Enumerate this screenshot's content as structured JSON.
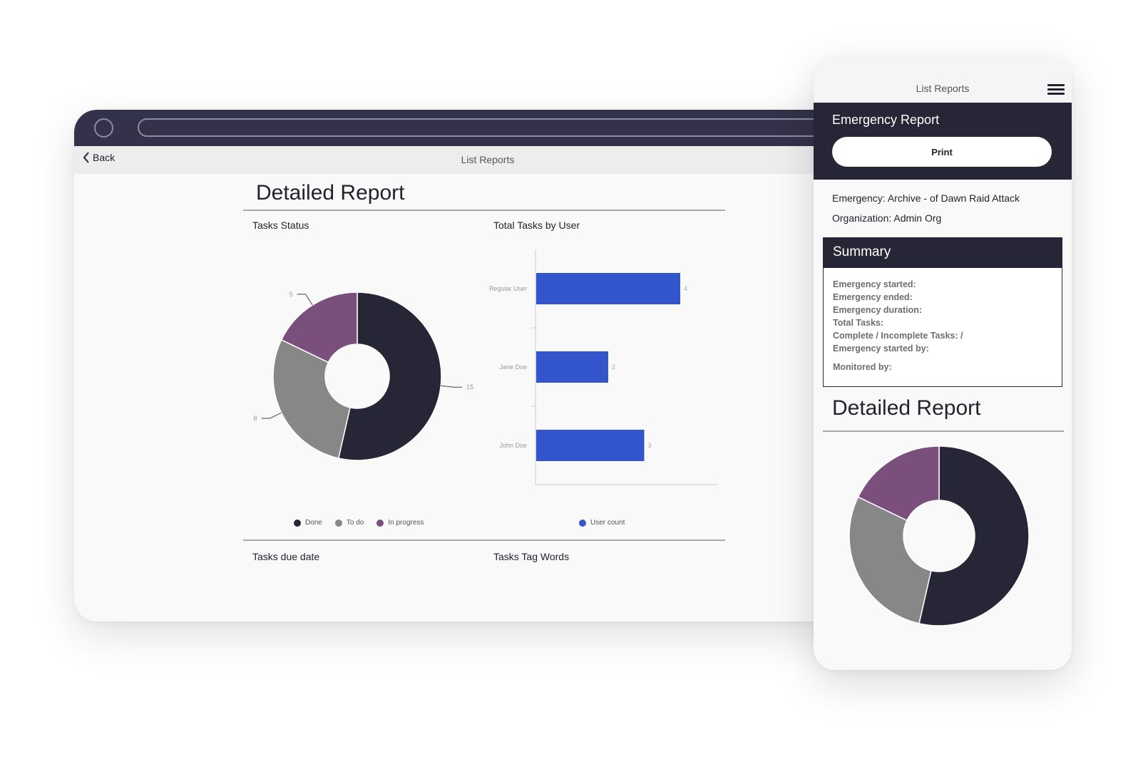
{
  "tablet": {
    "back_label": "Back",
    "nav_title": "List Reports",
    "report_title": "Detailed Report",
    "sections": {
      "tasks_status": "Tasks Status",
      "total_tasks_by_user": "Total Tasks by User",
      "tasks_due_date": "Tasks due date",
      "tasks_tag_words": "Tasks Tag Words"
    }
  },
  "phone": {
    "nav_title": "List Reports",
    "header_title": "Emergency Report",
    "print_label": "Print",
    "emergency_line": "Emergency: Archive - of Dawn Raid Attack",
    "organization_line": "Organization: Admin Org",
    "summary_title": "Summary",
    "summary_items": [
      "Emergency started:",
      "Emergency ended:",
      "Emergency duration:",
      "Total Tasks:",
      "Complete / Incomplete Tasks: /",
      "Emergency started by:",
      "Monitored by:"
    ],
    "report_title": "Detailed Report"
  },
  "colors": {
    "dark": "#262636",
    "gray": "#878787",
    "purple": "#7a4f7b",
    "blue": "#3355cc"
  },
  "chart_data": [
    {
      "type": "pie",
      "variant": "donut",
      "labels": [
        "Done",
        "To do",
        "In progress"
      ],
      "values": [
        15,
        8,
        5
      ],
      "colors": [
        "#262636",
        "#878787",
        "#7a4f7b"
      ],
      "legend": "bottom"
    },
    {
      "type": "bar",
      "orientation": "horizontal",
      "categories": [
        "Regular User",
        "Jane Doe",
        "John Doe"
      ],
      "series": [
        {
          "name": "User count",
          "values": [
            4,
            2,
            3
          ]
        }
      ],
      "colors": [
        "#3355cc"
      ],
      "legend": "bottom"
    },
    {
      "type": "pie",
      "variant": "donut",
      "labels": [
        "Done",
        "To do",
        "In progress"
      ],
      "values": [
        15,
        8,
        5
      ],
      "colors": [
        "#262636",
        "#878787",
        "#7a4f7b"
      ],
      "legend": "none"
    }
  ]
}
